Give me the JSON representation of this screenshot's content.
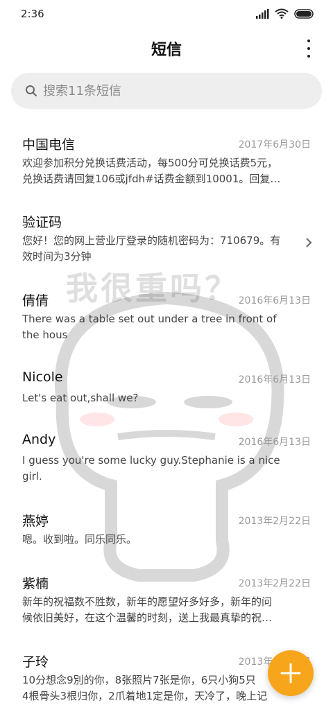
{
  "status_bar": {
    "time": "2:36"
  },
  "header": {
    "title": "短信"
  },
  "search": {
    "placeholder": "搜索11条短信"
  },
  "watermark": {
    "text": "我很重吗？"
  },
  "messages": [
    {
      "name": "中国电信",
      "date": "2017年6月30日",
      "preview": [
        "欢迎参加积分兑换话费活动，每500分可兑换话费5元，",
        "兑换话费请回复106或jfdh#话费金额到10001。回复…"
      ]
    },
    {
      "name": "验证码",
      "date": "",
      "preview": [
        "您好！您的网上营业厅登录的随机密码为：710679。有",
        "效时间为3分钟"
      ]
    },
    {
      "name": "倩倩",
      "date": "2016年6月13日",
      "preview": [
        "There was a table set out under a tree in front of",
        "the hous"
      ]
    },
    {
      "name": "Nicole",
      "date": "2016年6月13日",
      "preview": [
        "Let's eat out,shall we?",
        ""
      ]
    },
    {
      "name": "Andy",
      "date": "2016年6月13日",
      "preview": [
        "I guess you're some lucky guy.Stephanie is a nice",
        "girl."
      ]
    },
    {
      "name": "燕婷",
      "date": "2013年2月22日",
      "preview": [
        "嗯。收到啦。同乐同乐。",
        ""
      ]
    },
    {
      "name": "紫楠",
      "date": "2013年2月22日",
      "preview": [
        "新年的祝福数不胜数，新年的愿望好多好多，新年的问",
        "候依旧美好，在这个温馨的时刻，送上我最真挚的祝…"
      ]
    },
    {
      "name": "子玲",
      "date": "2013年2月22日",
      "preview": [
        "10分想念9別的你，8张照片7张是你，6只小狗5只",
        "4根骨头3根归你，2爪着地1定是你，天冷了，晚上记"
      ]
    }
  ],
  "fab": {
    "icon": "plus-icon",
    "color": "#f7a51a"
  }
}
